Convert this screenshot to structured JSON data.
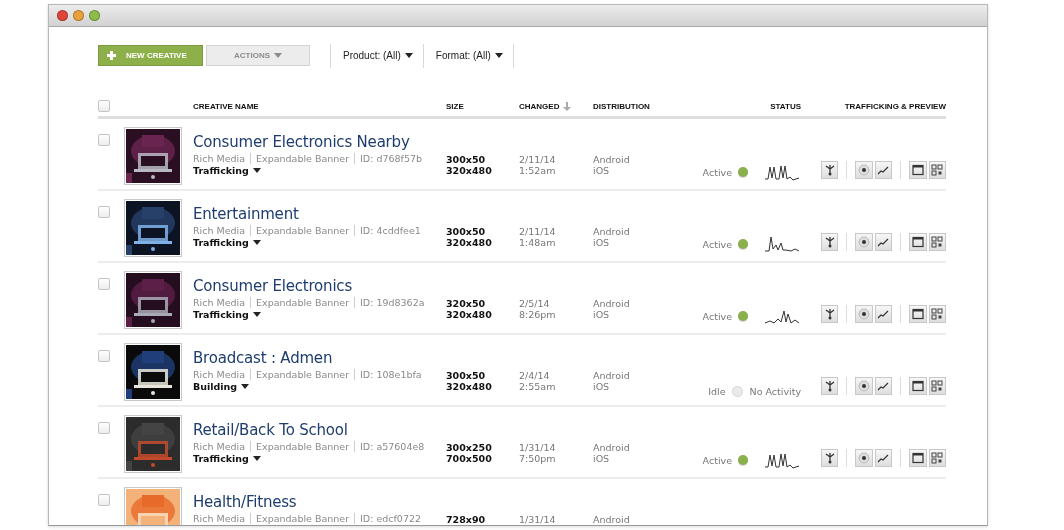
{
  "toolbar": {
    "new_button": "NEW CREATIVE",
    "actions_button": {
      "label": "ACTIONS",
      "disabled": true
    },
    "filters": [
      {
        "label": "Product: (All)"
      },
      {
        "label": "Format: (All)"
      }
    ]
  },
  "table": {
    "select_all": {
      "checked": false
    },
    "columns": [
      {
        "label": "CREATIVE NAME",
        "sorted": false
      },
      {
        "label": "SIZE",
        "sorted": false
      },
      {
        "label": "CHANGED",
        "sorted": true
      },
      {
        "label": "DISTRIBUTION",
        "sorted": false
      },
      {
        "label": "STATUS",
        "sorted": false
      },
      {
        "label": "TRAFFICKING & PREVIEW",
        "sorted": false
      }
    ],
    "rows": [
      {
        "checked": false,
        "name": "Consumer Electronics Nearby",
        "meta": [
          "Rich Media",
          "Expandable Banner",
          "ID: d768f57b"
        ],
        "state": "Trafficking",
        "sizes": [
          "300x50",
          "320x480"
        ],
        "changed": [
          "2/11/14",
          "1:52am"
        ],
        "distribution": [
          "Android",
          "iOS"
        ],
        "status": {
          "label": "Active",
          "active": true
        }
      },
      {
        "checked": false,
        "name": "Entertainment",
        "meta": [
          "Rich Media",
          "Expandable Banner",
          "ID: 4cddfee1"
        ],
        "state": "Trafficking",
        "sizes": [
          "300x50",
          "320x480"
        ],
        "changed": [
          "2/11/14",
          "1:48am"
        ],
        "distribution": [
          "Android",
          "iOS"
        ],
        "status": {
          "label": "Active",
          "active": true
        }
      },
      {
        "checked": false,
        "name": "Consumer Electronics",
        "meta": [
          "Rich Media",
          "Expandable Banner",
          "ID: 19d8362a"
        ],
        "state": "Trafficking",
        "sizes": [
          "320x50",
          "320x480"
        ],
        "changed": [
          "2/5/14",
          "8:26pm"
        ],
        "distribution": [
          "Android",
          "iOS"
        ],
        "status": {
          "label": "Active",
          "active": true
        }
      },
      {
        "checked": false,
        "name": "Broadcast : Admen",
        "meta": [
          "Rich Media",
          "Expandable Banner",
          "ID: 108e1bfa"
        ],
        "state": "Building",
        "sizes": [
          "300x50",
          "320x480"
        ],
        "changed": [
          "2/4/14",
          "2:55am"
        ],
        "distribution": [
          "Android",
          "iOS"
        ],
        "status": {
          "label": "Idle",
          "active": false,
          "note": "No Activity"
        }
      },
      {
        "checked": false,
        "name": "Retail/Back To School",
        "meta": [
          "Rich Media",
          "Expandable Banner",
          "ID: a57604e8"
        ],
        "state": "Trafficking",
        "sizes": [
          "300x250",
          "700x500"
        ],
        "changed": [
          "1/31/14",
          "7:50pm"
        ],
        "distribution": [
          "Android",
          "iOS"
        ],
        "status": {
          "label": "Active",
          "active": true
        }
      },
      {
        "checked": false,
        "name": "Health/Fitness",
        "meta": [
          "Rich Media",
          "Expandable Banner",
          "ID: edcf0722"
        ],
        "sizes": [
          "728x90"
        ],
        "changed": [
          "1/31/14"
        ],
        "distribution": [
          "Android"
        ]
      }
    ]
  }
}
